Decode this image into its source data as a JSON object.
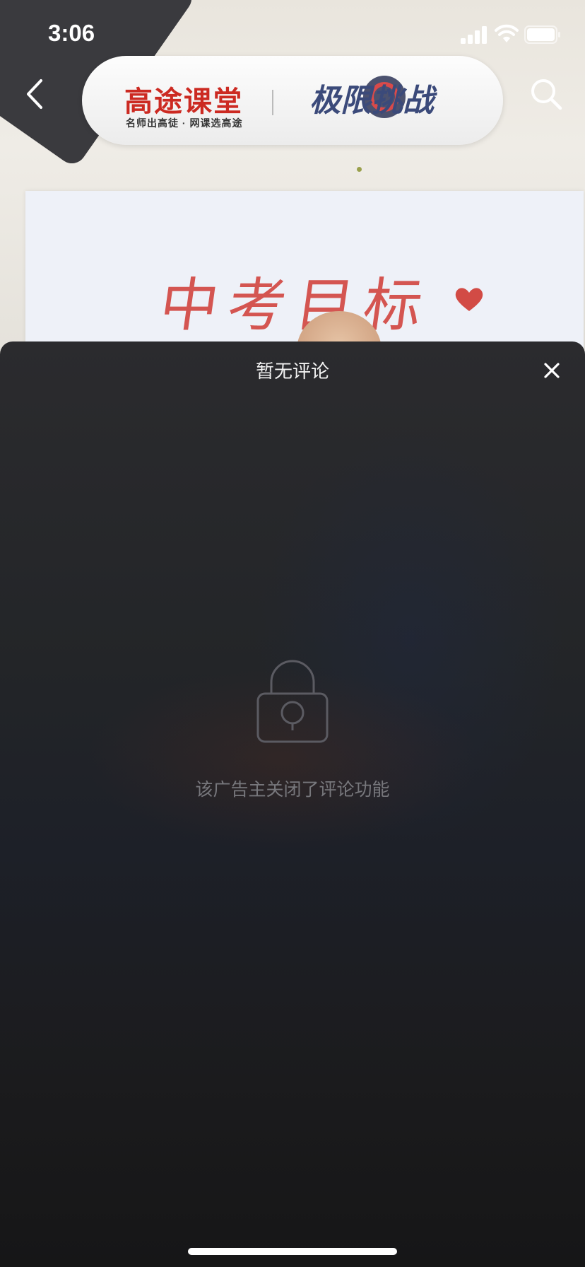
{
  "status_bar": {
    "time": "3:06"
  },
  "header": {
    "brand_name": "高途课堂",
    "brand_slogan": "名师出高徒 · 网课选高途",
    "challenge_title": "极限挑战"
  },
  "video": {
    "handwriting": "中考目标"
  },
  "comments_sheet": {
    "title": "暂无评论",
    "empty_message": "该广告主关闭了评论功能"
  },
  "colors": {
    "brand_red": "#cc2a22",
    "sheet_bg": "#232528",
    "muted_text": "#77777c"
  }
}
